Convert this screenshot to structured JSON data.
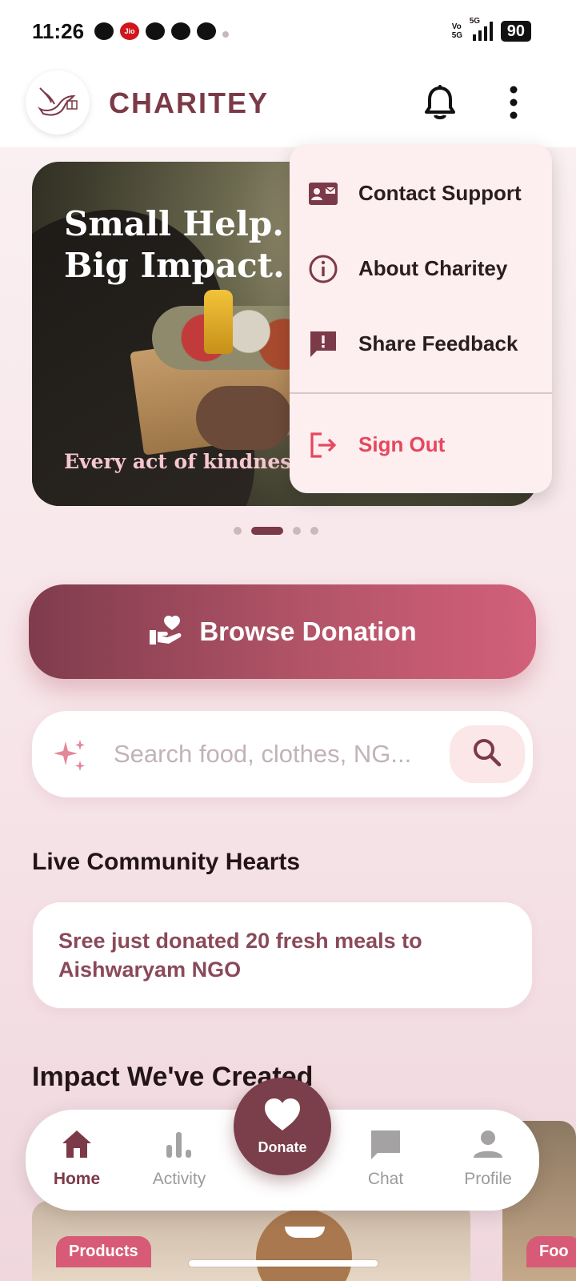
{
  "status_bar": {
    "time": "11:26",
    "network": "5G",
    "volte": "Vo 5G",
    "battery": "90",
    "notif_icons": [
      "chat-icon",
      "jio-icon",
      "app-icon",
      "app-icon",
      "app-icon",
      "dot-icon"
    ]
  },
  "header": {
    "app_name": "CHARITEY",
    "logo_icon": "dove-gift-icon",
    "notification_icon": "bell-icon",
    "menu_icon": "more-vertical-icon"
  },
  "banner": {
    "headline_1": "Small Help.",
    "headline_2": "Big Impact.",
    "subtitle": "Every act of kindnes",
    "carousel_total": 4,
    "carousel_active": 2
  },
  "menu": {
    "items": [
      {
        "label": "Contact Support",
        "icon": "contact-card-icon"
      },
      {
        "label": "About Charitey",
        "icon": "info-icon"
      },
      {
        "label": "Share Feedback",
        "icon": "feedback-icon"
      }
    ],
    "sign_out": {
      "label": "Sign Out",
      "icon": "logout-icon"
    }
  },
  "browse": {
    "label": "Browse Donation",
    "icon": "hand-heart-icon"
  },
  "search": {
    "placeholder": "Search food, clothes, NG...",
    "value": ""
  },
  "live_section": {
    "title": "Live Community Hearts",
    "message": "Sree just donated 20 fresh meals to Aishwaryam NGO"
  },
  "impact_section": {
    "title": "Impact We've Created",
    "cards": [
      {
        "badge": "Products"
      },
      {
        "badge": "Foo"
      }
    ]
  },
  "nav": {
    "items": [
      {
        "label": "Home",
        "icon": "home-icon",
        "active": true
      },
      {
        "label": "Activity",
        "icon": "bar-chart-icon",
        "active": false
      },
      {
        "label": "Chat",
        "icon": "chat-bubble-icon",
        "active": false
      },
      {
        "label": "Profile",
        "icon": "person-icon",
        "active": false
      }
    ],
    "donate": {
      "label": "Donate",
      "icon": "heart-icon"
    }
  },
  "colors": {
    "brand": "#7b3a47",
    "accent": "#d2607a",
    "danger": "#e5485e",
    "background": "#fbf2f3"
  }
}
